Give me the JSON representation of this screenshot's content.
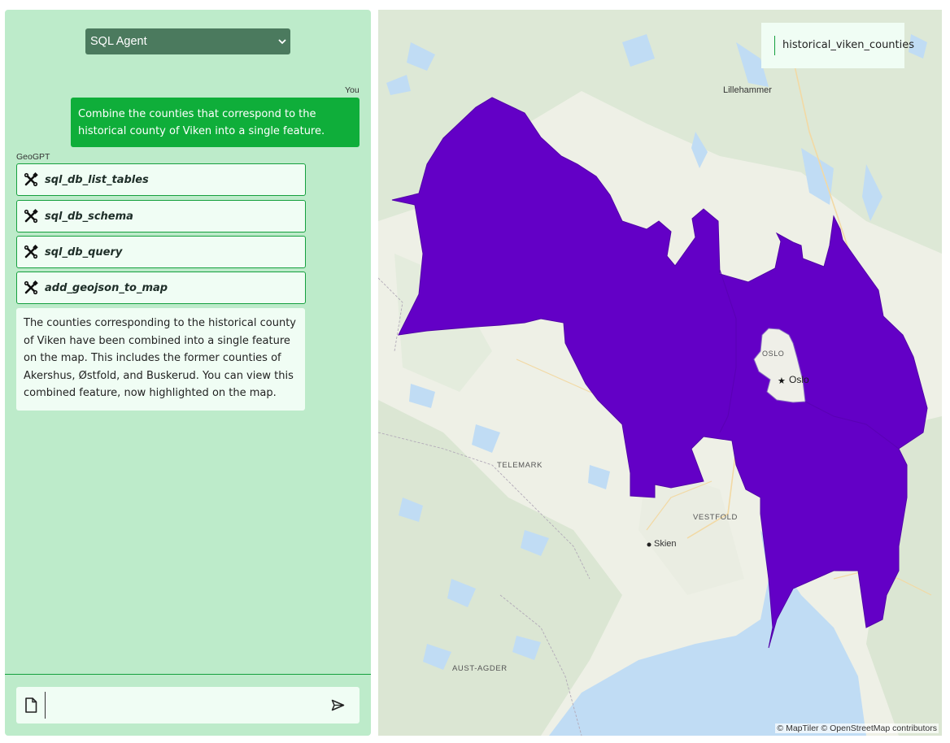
{
  "agent_select": {
    "value": "SQL Agent"
  },
  "chat": {
    "user_sender": "You",
    "assistant_sender": "GeoGPT",
    "user_message": "Combine the counties that correspond to the historical county of Viken into a single feature.",
    "tool_calls": [
      {
        "label": "sql_db_list_tables",
        "icon": "tools-icon"
      },
      {
        "label": "sql_db_schema",
        "icon": "tools-icon"
      },
      {
        "label": "sql_db_query",
        "icon": "tools-icon"
      },
      {
        "label": "add_geojson_to_map",
        "icon": "tools-icon"
      }
    ],
    "assistant_message": "The counties corresponding to the historical county of Viken have been combined into a single feature on the map. This includes the former counties of Akershus, Østfold, and Buskerud. You can view this combined feature, now highlighted on the map.",
    "input": {
      "value": "",
      "placeholder": ""
    }
  },
  "map": {
    "layer_name": "historical_viken_counties",
    "feature_color": "#6300c6",
    "water_color": "#c0dcf4",
    "labels": {
      "lillehammer": "Lillehammer",
      "oslo_county": "OSLO",
      "oslo_city": "Oslo",
      "telemark": "TELEMARK",
      "vestfold": "VESTFOLD",
      "skien": "Skien",
      "aust_agder": "AUST-AGDER"
    },
    "attribution": "© MapTiler © OpenStreetMap contributors"
  },
  "colors": {
    "panel_bg": "#bdebca",
    "accent_green": "#0fae3a",
    "select_bg": "#4b7a5e"
  }
}
